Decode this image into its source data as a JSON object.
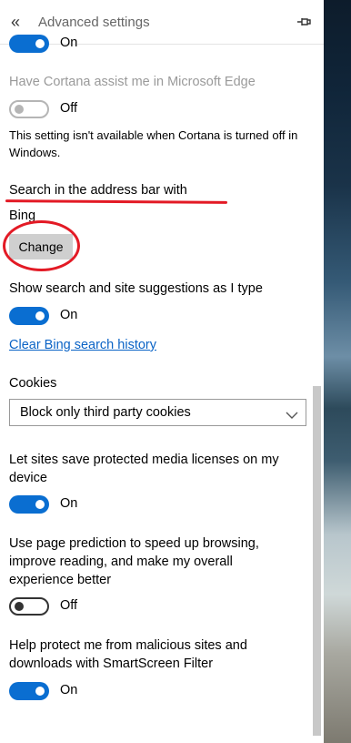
{
  "header": {
    "title": "Advanced settings"
  },
  "cortana_top": {
    "state": "On"
  },
  "cortana_assist": {
    "label": "Have Cortana assist me in Microsoft Edge",
    "state": "Off",
    "note": "This setting isn't available when Cortana is turned off in Windows."
  },
  "search": {
    "heading": "Search in the address bar with",
    "engine": "Bing",
    "change_label": "Change"
  },
  "suggestions": {
    "label": "Show search and site suggestions as I type",
    "state": "On"
  },
  "clear_history": {
    "label": "Clear Bing search history"
  },
  "cookies": {
    "label": "Cookies",
    "selected": "Block only third party cookies"
  },
  "media_licenses": {
    "label_line1": "Let sites save protected media licenses on my",
    "label_line2": "device",
    "state": "On"
  },
  "page_prediction": {
    "label_line1": "Use page prediction to speed up browsing,",
    "label_line2": "improve reading, and make my overall",
    "label_line3": "experience better",
    "state": "Off"
  },
  "smartscreen": {
    "label_line1": "Help protect me from malicious sites and",
    "label_line2": "downloads with SmartScreen Filter",
    "state": "On"
  },
  "colors": {
    "accent": "#0a6ed1",
    "link": "#0a63c6",
    "annotation": "#e31a25"
  }
}
